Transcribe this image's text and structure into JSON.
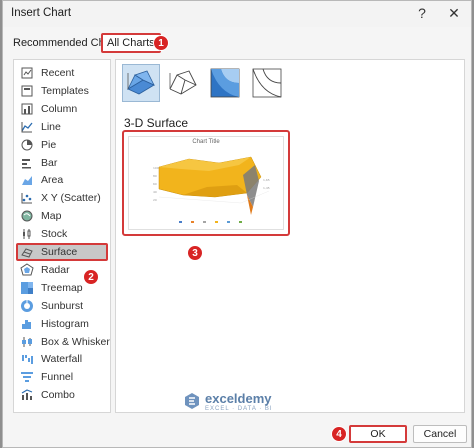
{
  "window": {
    "title": "Insert Chart",
    "help_glyph": "?",
    "close_glyph": "✕"
  },
  "tabs": [
    {
      "label": "Recommended Charts"
    },
    {
      "label": "All Charts"
    }
  ],
  "categories": [
    {
      "label": "Recent",
      "icon": "recent-icon"
    },
    {
      "label": "Templates",
      "icon": "templates-icon"
    },
    {
      "label": "Column",
      "icon": "column-chart-icon"
    },
    {
      "label": "Line",
      "icon": "line-chart-icon"
    },
    {
      "label": "Pie",
      "icon": "pie-chart-icon"
    },
    {
      "label": "Bar",
      "icon": "bar-chart-icon"
    },
    {
      "label": "Area",
      "icon": "area-chart-icon"
    },
    {
      "label": "X Y (Scatter)",
      "icon": "scatter-chart-icon"
    },
    {
      "label": "Map",
      "icon": "map-chart-icon"
    },
    {
      "label": "Stock",
      "icon": "stock-chart-icon"
    },
    {
      "label": "Surface",
      "icon": "surface-chart-icon"
    },
    {
      "label": "Radar",
      "icon": "radar-chart-icon"
    },
    {
      "label": "Treemap",
      "icon": "treemap-chart-icon"
    },
    {
      "label": "Sunburst",
      "icon": "sunburst-chart-icon"
    },
    {
      "label": "Histogram",
      "icon": "histogram-chart-icon"
    },
    {
      "label": "Box & Whisker",
      "icon": "box-whisker-chart-icon"
    },
    {
      "label": "Waterfall",
      "icon": "waterfall-chart-icon"
    },
    {
      "label": "Funnel",
      "icon": "funnel-chart-icon"
    },
    {
      "label": "Combo",
      "icon": "combo-chart-icon"
    }
  ],
  "selected_category": "Surface",
  "subtypes": [
    {
      "name": "3-D Surface",
      "icon": "3d-surface-icon",
      "selected": true
    },
    {
      "name": "Wireframe 3-D Surface",
      "icon": "wireframe-3d-surface-icon",
      "selected": false
    },
    {
      "name": "Contour",
      "icon": "contour-icon",
      "selected": false
    },
    {
      "name": "Wireframe Contour",
      "icon": "wireframe-contour-icon",
      "selected": false
    }
  ],
  "section_title": "3-D Surface",
  "preview": {
    "chart_title": "Chart Title"
  },
  "buttons": {
    "ok": "OK",
    "cancel": "Cancel"
  },
  "annotations": {
    "b1": "1",
    "b2": "2",
    "b3": "3",
    "b4": "4"
  },
  "watermark": {
    "name": "exceldemy",
    "tagline": "EXCEL · DATA · BI"
  },
  "colors": {
    "highlight": "#d43a3a",
    "badge": "#d82424",
    "selected_subtype": "#cfe2f3",
    "surface": "#f2b41c"
  }
}
